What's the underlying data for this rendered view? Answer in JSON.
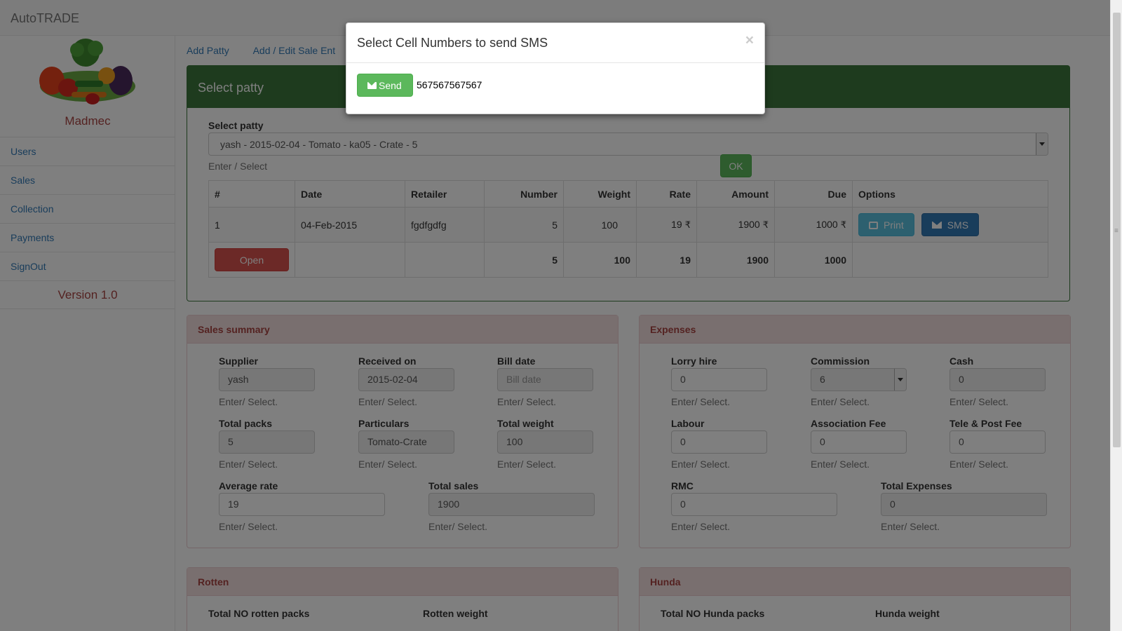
{
  "app": {
    "brand": "AutoTRADE"
  },
  "sidebar": {
    "org": "Madmec",
    "items": [
      "Users",
      "Sales",
      "Collection",
      "Payments",
      "SignOut"
    ],
    "version": "Version 1.0"
  },
  "tabs": [
    "Add Patty",
    "Add / Edit Sale Ent"
  ],
  "patty_panel": {
    "title": "Select patty",
    "select_label": "Select patty",
    "select_value": "yash - 2015-02-04 - Tomato - ka05 - Crate - 5",
    "help": "Enter / Select",
    "ok_label": "OK",
    "table": {
      "headers": [
        "#",
        "Date",
        "Retailer",
        "Number",
        "Weight",
        "Rate",
        "Amount",
        "Due",
        "Options"
      ],
      "row": {
        "n": "1",
        "date": "04-Feb-2015",
        "retailer": "fgdfgdfg",
        "number": "5",
        "weight": "100",
        "rate": "19",
        "amount": "1900",
        "due": "1000"
      },
      "currency": "₹",
      "print_label": "Print",
      "sms_label": "SMS",
      "totals": {
        "open_label": "Open",
        "number": "5",
        "weight": "100",
        "rate": "19",
        "amount": "1900",
        "due": "1000"
      }
    }
  },
  "help_text": "Enter/ Select.",
  "sales_summary": {
    "title": "Sales summary",
    "supplier": {
      "label": "Supplier",
      "value": "yash"
    },
    "received_on": {
      "label": "Received on",
      "value": "2015-02-04"
    },
    "bill_date": {
      "label": "Bill date",
      "placeholder": "Bill date"
    },
    "total_packs": {
      "label": "Total packs",
      "value": "5"
    },
    "particulars": {
      "label": "Particulars",
      "value": "Tomato-Crate"
    },
    "total_weight": {
      "label": "Total weight",
      "value": "100"
    },
    "average_rate": {
      "label": "Average rate",
      "value": "19"
    },
    "total_sales": {
      "label": "Total sales",
      "value": "1900"
    }
  },
  "expenses": {
    "title": "Expenses",
    "lorry_hire": {
      "label": "Lorry hire",
      "value": "0"
    },
    "commission": {
      "label": "Commission",
      "value": "6"
    },
    "cash": {
      "label": "Cash",
      "value": "0"
    },
    "labour": {
      "label": "Labour",
      "value": "0"
    },
    "association_fee": {
      "label": "Association Fee",
      "value": "0"
    },
    "tele_post_fee": {
      "label": "Tele & Post Fee",
      "value": "0"
    },
    "rmc": {
      "label": "RMC",
      "value": "0"
    },
    "total_expenses": {
      "label": "Total Expenses",
      "value": "0"
    }
  },
  "rotten": {
    "title": "Rotten",
    "packs_label": "Total NO rotten packs",
    "weight_label": "Rotten weight"
  },
  "hunda": {
    "title": "Hunda",
    "packs_label": "Total NO Hunda packs",
    "weight_label": "Hunda weight"
  },
  "modal": {
    "title": "Select Cell Numbers to send SMS",
    "close": "×",
    "send_label": "Send",
    "number": "567567567567"
  }
}
